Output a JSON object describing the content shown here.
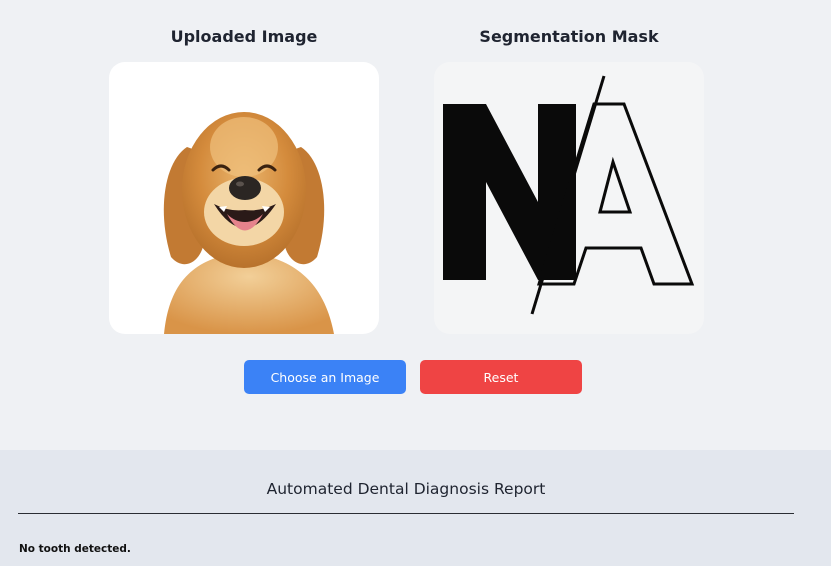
{
  "upload_panel": {
    "title": "Uploaded Image",
    "image_subject": "golden-retriever-photo"
  },
  "mask_panel": {
    "title": "Segmentation Mask",
    "placeholder_image": "na-placeholder"
  },
  "actions": {
    "choose_label": "Choose an Image",
    "reset_label": "Reset"
  },
  "report": {
    "title": "Automated Dental Diagnosis Report",
    "result_text": "No tooth detected."
  },
  "colors": {
    "choose_button": "#3b82f6",
    "reset_button": "#ef4444",
    "page_background": "#eff1f4",
    "report_background": "#e3e7ee"
  }
}
